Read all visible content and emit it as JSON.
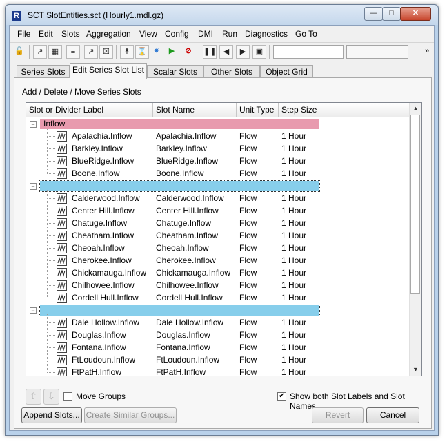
{
  "window": {
    "title": "SCT SlotEntities.sct (Hourly1.mdl.gz)",
    "app_icon_glyph": "R"
  },
  "menu": [
    "File",
    "Edit",
    "Slots",
    "Aggregation",
    "View",
    "Config",
    "DMI",
    "Run",
    "Diagnostics",
    "Go To"
  ],
  "toolbar": {
    "overflow_glyph": "»"
  },
  "tabs": [
    "Series Slots",
    "Edit Series Slot List",
    "Scalar Slots",
    "Other Slots",
    "Object Grid"
  ],
  "panel": {
    "section_title": "Add / Delete / Move Series Slots"
  },
  "columns": [
    "Slot or Divider Label",
    "Slot Name",
    "Unit Type",
    "Step Size"
  ],
  "groups": [
    {
      "label": "Inflow",
      "color": "#e89aae",
      "rows": [
        [
          "Apalachia.Inflow",
          "Apalachia.Inflow",
          "Flow",
          "1 Hour"
        ],
        [
          "Barkley.Inflow",
          "Barkley.Inflow",
          "Flow",
          "1 Hour"
        ],
        [
          "BlueRidge.Inflow",
          "BlueRidge.Inflow",
          "Flow",
          "1 Hour"
        ],
        [
          "Boone.Inflow",
          "Boone.Inflow",
          "Flow",
          "1 Hour"
        ]
      ]
    },
    {
      "label": "",
      "color": "#87ceeb",
      "rows": [
        [
          "Calderwood.Inflow",
          "Calderwood.Inflow",
          "Flow",
          "1 Hour"
        ],
        [
          "Center Hill.Inflow",
          "Center Hill.Inflow",
          "Flow",
          "1 Hour"
        ],
        [
          "Chatuge.Inflow",
          "Chatuge.Inflow",
          "Flow",
          "1 Hour"
        ],
        [
          "Cheatham.Inflow",
          "Cheatham.Inflow",
          "Flow",
          "1 Hour"
        ],
        [
          "Cheoah.Inflow",
          "Cheoah.Inflow",
          "Flow",
          "1 Hour"
        ],
        [
          "Cherokee.Inflow",
          "Cherokee.Inflow",
          "Flow",
          "1 Hour"
        ],
        [
          "Chickamauga.Inflow",
          "Chickamauga.Inflow",
          "Flow",
          "1 Hour"
        ],
        [
          "Chilhowee.Inflow",
          "Chilhowee.Inflow",
          "Flow",
          "1 Hour"
        ],
        [
          "Cordell Hull.Inflow",
          "Cordell Hull.Inflow",
          "Flow",
          "1 Hour"
        ]
      ]
    },
    {
      "label": "",
      "color": "#87ceeb",
      "rows": [
        [
          "Dale Hollow.Inflow",
          "Dale Hollow.Inflow",
          "Flow",
          "1 Hour"
        ],
        [
          "Douglas.Inflow",
          "Douglas.Inflow",
          "Flow",
          "1 Hour"
        ],
        [
          "Fontana.Inflow",
          "Fontana.Inflow",
          "Flow",
          "1 Hour"
        ],
        [
          "FtLoudoun.Inflow",
          "FtLoudoun.Inflow",
          "Flow",
          "1 Hour"
        ],
        [
          "FtPatH.Inflow",
          "FtPatH.Inflow",
          "Flow",
          "1 Hour"
        ]
      ]
    }
  ],
  "controls": {
    "move_groups": {
      "label": "Move Groups",
      "checked": false
    },
    "show_both": {
      "label": "Show both Slot Labels and Slot Names",
      "checked": true
    }
  },
  "buttons": {
    "append": "Append Slots...",
    "create_similar": "Create Similar Groups...",
    "revert": "Revert",
    "cancel": "Cancel"
  }
}
